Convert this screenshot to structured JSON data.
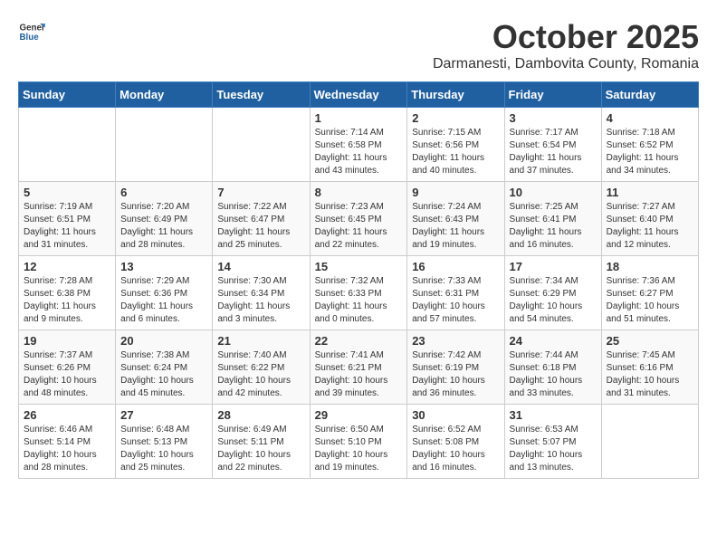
{
  "header": {
    "logo_general": "General",
    "logo_blue": "Blue",
    "month": "October 2025",
    "location": "Darmanesti, Dambovita County, Romania"
  },
  "days_of_week": [
    "Sunday",
    "Monday",
    "Tuesday",
    "Wednesday",
    "Thursday",
    "Friday",
    "Saturday"
  ],
  "weeks": [
    [
      {
        "day": "",
        "info": ""
      },
      {
        "day": "",
        "info": ""
      },
      {
        "day": "",
        "info": ""
      },
      {
        "day": "1",
        "info": "Sunrise: 7:14 AM\nSunset: 6:58 PM\nDaylight: 11 hours\nand 43 minutes."
      },
      {
        "day": "2",
        "info": "Sunrise: 7:15 AM\nSunset: 6:56 PM\nDaylight: 11 hours\nand 40 minutes."
      },
      {
        "day": "3",
        "info": "Sunrise: 7:17 AM\nSunset: 6:54 PM\nDaylight: 11 hours\nand 37 minutes."
      },
      {
        "day": "4",
        "info": "Sunrise: 7:18 AM\nSunset: 6:52 PM\nDaylight: 11 hours\nand 34 minutes."
      }
    ],
    [
      {
        "day": "5",
        "info": "Sunrise: 7:19 AM\nSunset: 6:51 PM\nDaylight: 11 hours\nand 31 minutes."
      },
      {
        "day": "6",
        "info": "Sunrise: 7:20 AM\nSunset: 6:49 PM\nDaylight: 11 hours\nand 28 minutes."
      },
      {
        "day": "7",
        "info": "Sunrise: 7:22 AM\nSunset: 6:47 PM\nDaylight: 11 hours\nand 25 minutes."
      },
      {
        "day": "8",
        "info": "Sunrise: 7:23 AM\nSunset: 6:45 PM\nDaylight: 11 hours\nand 22 minutes."
      },
      {
        "day": "9",
        "info": "Sunrise: 7:24 AM\nSunset: 6:43 PM\nDaylight: 11 hours\nand 19 minutes."
      },
      {
        "day": "10",
        "info": "Sunrise: 7:25 AM\nSunset: 6:41 PM\nDaylight: 11 hours\nand 16 minutes."
      },
      {
        "day": "11",
        "info": "Sunrise: 7:27 AM\nSunset: 6:40 PM\nDaylight: 11 hours\nand 12 minutes."
      }
    ],
    [
      {
        "day": "12",
        "info": "Sunrise: 7:28 AM\nSunset: 6:38 PM\nDaylight: 11 hours\nand 9 minutes."
      },
      {
        "day": "13",
        "info": "Sunrise: 7:29 AM\nSunset: 6:36 PM\nDaylight: 11 hours\nand 6 minutes."
      },
      {
        "day": "14",
        "info": "Sunrise: 7:30 AM\nSunset: 6:34 PM\nDaylight: 11 hours\nand 3 minutes."
      },
      {
        "day": "15",
        "info": "Sunrise: 7:32 AM\nSunset: 6:33 PM\nDaylight: 11 hours\nand 0 minutes."
      },
      {
        "day": "16",
        "info": "Sunrise: 7:33 AM\nSunset: 6:31 PM\nDaylight: 10 hours\nand 57 minutes."
      },
      {
        "day": "17",
        "info": "Sunrise: 7:34 AM\nSunset: 6:29 PM\nDaylight: 10 hours\nand 54 minutes."
      },
      {
        "day": "18",
        "info": "Sunrise: 7:36 AM\nSunset: 6:27 PM\nDaylight: 10 hours\nand 51 minutes."
      }
    ],
    [
      {
        "day": "19",
        "info": "Sunrise: 7:37 AM\nSunset: 6:26 PM\nDaylight: 10 hours\nand 48 minutes."
      },
      {
        "day": "20",
        "info": "Sunrise: 7:38 AM\nSunset: 6:24 PM\nDaylight: 10 hours\nand 45 minutes."
      },
      {
        "day": "21",
        "info": "Sunrise: 7:40 AM\nSunset: 6:22 PM\nDaylight: 10 hours\nand 42 minutes."
      },
      {
        "day": "22",
        "info": "Sunrise: 7:41 AM\nSunset: 6:21 PM\nDaylight: 10 hours\nand 39 minutes."
      },
      {
        "day": "23",
        "info": "Sunrise: 7:42 AM\nSunset: 6:19 PM\nDaylight: 10 hours\nand 36 minutes."
      },
      {
        "day": "24",
        "info": "Sunrise: 7:44 AM\nSunset: 6:18 PM\nDaylight: 10 hours\nand 33 minutes."
      },
      {
        "day": "25",
        "info": "Sunrise: 7:45 AM\nSunset: 6:16 PM\nDaylight: 10 hours\nand 31 minutes."
      }
    ],
    [
      {
        "day": "26",
        "info": "Sunrise: 6:46 AM\nSunset: 5:14 PM\nDaylight: 10 hours\nand 28 minutes."
      },
      {
        "day": "27",
        "info": "Sunrise: 6:48 AM\nSunset: 5:13 PM\nDaylight: 10 hours\nand 25 minutes."
      },
      {
        "day": "28",
        "info": "Sunrise: 6:49 AM\nSunset: 5:11 PM\nDaylight: 10 hours\nand 22 minutes."
      },
      {
        "day": "29",
        "info": "Sunrise: 6:50 AM\nSunset: 5:10 PM\nDaylight: 10 hours\nand 19 minutes."
      },
      {
        "day": "30",
        "info": "Sunrise: 6:52 AM\nSunset: 5:08 PM\nDaylight: 10 hours\nand 16 minutes."
      },
      {
        "day": "31",
        "info": "Sunrise: 6:53 AM\nSunset: 5:07 PM\nDaylight: 10 hours\nand 13 minutes."
      },
      {
        "day": "",
        "info": ""
      }
    ]
  ]
}
